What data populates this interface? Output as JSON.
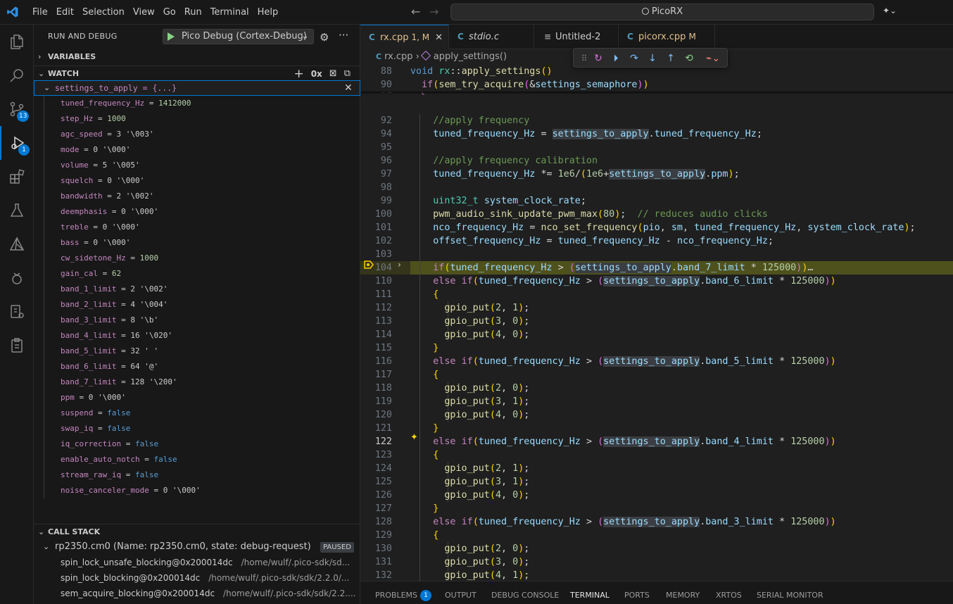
{
  "titlebar": {
    "menus": [
      "File",
      "Edit",
      "Selection",
      "View",
      "Go",
      "Run",
      "Terminal",
      "Help"
    ],
    "command_center": "PicoRX"
  },
  "activity": {
    "scm_badge": "13",
    "debug_badge": "1"
  },
  "sidebar": {
    "title": "RUN AND DEBUG",
    "config": "Pico Debug (Cortex-Debug)",
    "variables_header": "VARIABLES",
    "watch_header": "WATCH",
    "watch_hex_label": "0x",
    "watch_root": "settings_to_apply = {...}",
    "watch_items": [
      {
        "name": "tuned_frequency_Hz",
        "value": "1412000",
        "kind": "num"
      },
      {
        "name": "step_Hz",
        "value": "1000",
        "kind": "num"
      },
      {
        "name": "agc_speed",
        "value": "3 '\\003'",
        "kind": "plain"
      },
      {
        "name": "mode",
        "value": "0 '\\000'",
        "kind": "plain"
      },
      {
        "name": "volume",
        "value": "5 '\\005'",
        "kind": "plain"
      },
      {
        "name": "squelch",
        "value": "0 '\\000'",
        "kind": "plain"
      },
      {
        "name": "bandwidth",
        "value": "2 '\\002'",
        "kind": "plain"
      },
      {
        "name": "deemphasis",
        "value": "0 '\\000'",
        "kind": "plain"
      },
      {
        "name": "treble",
        "value": "0 '\\000'",
        "kind": "plain"
      },
      {
        "name": "bass",
        "value": "0 '\\000'",
        "kind": "plain"
      },
      {
        "name": "cw_sidetone_Hz",
        "value": "1000",
        "kind": "num"
      },
      {
        "name": "gain_cal",
        "value": "62",
        "kind": "num"
      },
      {
        "name": "band_1_limit",
        "value": "2 '\\002'",
        "kind": "plain"
      },
      {
        "name": "band_2_limit",
        "value": "4 '\\004'",
        "kind": "plain"
      },
      {
        "name": "band_3_limit",
        "value": "8 '\\b'",
        "kind": "plain"
      },
      {
        "name": "band_4_limit",
        "value": "16 '\\020'",
        "kind": "plain"
      },
      {
        "name": "band_5_limit",
        "value": "32 ' '",
        "kind": "plain"
      },
      {
        "name": "band_6_limit",
        "value": "64 '@'",
        "kind": "plain"
      },
      {
        "name": "band_7_limit",
        "value": "128 '\\200'",
        "kind": "plain"
      },
      {
        "name": "ppm",
        "value": "0 '\\000'",
        "kind": "plain"
      },
      {
        "name": "suspend",
        "value": "false",
        "kind": "bool"
      },
      {
        "name": "swap_iq",
        "value": "false",
        "kind": "bool"
      },
      {
        "name": "iq_correction",
        "value": "false",
        "kind": "bool"
      },
      {
        "name": "enable_auto_notch",
        "value": "false",
        "kind": "bool"
      },
      {
        "name": "stream_raw_iq",
        "value": "false",
        "kind": "bool"
      },
      {
        "name": "noise_canceler_mode",
        "value": "0 '\\000'",
        "kind": "plain"
      }
    ],
    "callstack_header": "CALL STACK",
    "thread": "rp2350.cm0 (Name: rp2350.cm0, state: debug-request)",
    "thread_state": "PAUSED",
    "frames": [
      {
        "fn": "spin_lock_unsafe_blocking@0x200014dc",
        "path": "/home/wulf/.pico-sdk/sd..."
      },
      {
        "fn": "spin_lock_blocking@0x200014dc",
        "path": "/home/wulf/.pico-sdk/sdk/2.2.0/..."
      },
      {
        "fn": "sem_acquire_blocking@0x200014dc",
        "path": "/home/wulf/.pico-sdk/sdk/2.2...."
      }
    ]
  },
  "tabs": [
    {
      "icon": "C",
      "name": "rx.cpp",
      "status": "1, M",
      "active": true
    },
    {
      "icon": "C",
      "name": "stdio.c",
      "status": "",
      "active": false
    },
    {
      "icon": "≡",
      "name": "Untitled-2",
      "status": "",
      "active": false
    },
    {
      "icon": "C",
      "name": "picorx.cpp",
      "status": "M",
      "active": false
    }
  ],
  "breadcrumb": {
    "file": "rx.cpp",
    "symbol": "apply_settings()"
  },
  "code": {
    "lines": [
      {
        "n": "88",
        "t": "void rx::apply_settings()"
      },
      {
        "n": "90",
        "t": "  if(sem_try_acquire(&settings_semaphore))"
      },
      {
        "n": "92",
        "t": "    //apply frequency"
      },
      {
        "n": "94",
        "t": "    tuned_frequency_Hz = settings_to_apply.tuned_frequency_Hz;"
      },
      {
        "n": "95",
        "t": ""
      },
      {
        "n": "96",
        "t": "    //apply frequency calibration"
      },
      {
        "n": "97",
        "t": "    tuned_frequency_Hz *= 1e6/(1e6+settings_to_apply.ppm);"
      },
      {
        "n": "98",
        "t": ""
      },
      {
        "n": "99",
        "t": "    uint32_t system_clock_rate;"
      },
      {
        "n": "100",
        "t": "    pwm_audio_sink_update_pwm_max(80);  // reduces audio clicks"
      },
      {
        "n": "101",
        "t": "    nco_frequency_Hz = nco_set_frequency(pio, sm, tuned_frequency_Hz, system_clock_rate);"
      },
      {
        "n": "102",
        "t": "    offset_frequency_Hz = tuned_frequency_Hz - nco_frequency_Hz;"
      },
      {
        "n": "103",
        "t": ""
      },
      {
        "n": "104",
        "t": "    if(tuned_frequency_Hz > (settings_to_apply.band_7_limit * 125000))…"
      },
      {
        "n": "110",
        "t": "    else if(tuned_frequency_Hz > (settings_to_apply.band_6_limit * 125000))"
      },
      {
        "n": "111",
        "t": "    {"
      },
      {
        "n": "112",
        "t": "      gpio_put(2, 1);"
      },
      {
        "n": "113",
        "t": "      gpio_put(3, 0);"
      },
      {
        "n": "114",
        "t": "      gpio_put(4, 0);"
      },
      {
        "n": "115",
        "t": "    }"
      },
      {
        "n": "116",
        "t": "    else if(tuned_frequency_Hz > (settings_to_apply.band_5_limit * 125000))"
      },
      {
        "n": "117",
        "t": "    {"
      },
      {
        "n": "118",
        "t": "      gpio_put(2, 0);"
      },
      {
        "n": "119",
        "t": "      gpio_put(3, 1);"
      },
      {
        "n": "120",
        "t": "      gpio_put(4, 0);"
      },
      {
        "n": "121",
        "t": "    }"
      },
      {
        "n": "122",
        "t": "    else if(tuned_frequency_Hz > (settings_to_apply.band_4_limit * 125000))"
      },
      {
        "n": "123",
        "t": "    {"
      },
      {
        "n": "124",
        "t": "      gpio_put(2, 1);"
      },
      {
        "n": "125",
        "t": "      gpio_put(3, 1);"
      },
      {
        "n": "126",
        "t": "      gpio_put(4, 0);"
      },
      {
        "n": "127",
        "t": "    }"
      },
      {
        "n": "128",
        "t": "    else if(tuned_frequency_Hz > (settings_to_apply.band_3_limit * 125000))"
      },
      {
        "n": "129",
        "t": "    {"
      },
      {
        "n": "130",
        "t": "      gpio_put(2, 0);"
      },
      {
        "n": "131",
        "t": "      gpio_put(3, 0);"
      },
      {
        "n": "132",
        "t": "      gpio_put(4, 1);"
      }
    ]
  },
  "panel_tabs": [
    {
      "label": "PROBLEMS",
      "badge": "1"
    },
    {
      "label": "OUTPUT"
    },
    {
      "label": "DEBUG CONSOLE"
    },
    {
      "label": "TERMINAL",
      "active": true
    },
    {
      "label": "PORTS"
    },
    {
      "label": "MEMORY"
    },
    {
      "label": "XRTOS"
    },
    {
      "label": "SERIAL MONITOR"
    }
  ]
}
